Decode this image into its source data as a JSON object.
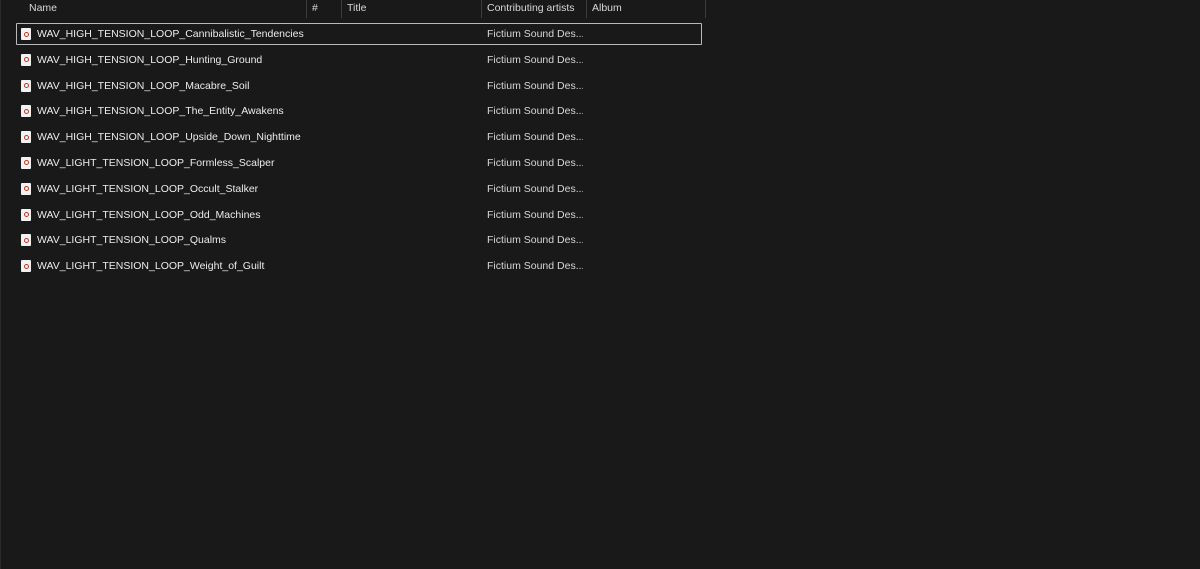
{
  "columns": {
    "name": "Name",
    "number": "#",
    "title": "Title",
    "contributing_artists": "Contributing artists",
    "album": "Album"
  },
  "files": [
    {
      "name": "WAV_HIGH_TENSION_LOOP_Cannibalistic_Tendencies",
      "artist": "Fictium Sound Des...",
      "selected": true,
      "icon": "audio-file-icon"
    },
    {
      "name": "WAV_HIGH_TENSION_LOOP_Hunting_Ground",
      "artist": "Fictium Sound Des...",
      "icon": "audio-file-icon"
    },
    {
      "name": "WAV_HIGH_TENSION_LOOP_Macabre_Soil",
      "artist": "Fictium Sound Des...",
      "icon": "audio-file-icon"
    },
    {
      "name": "WAV_HIGH_TENSION_LOOP_The_Entity_Awakens",
      "artist": "Fictium Sound Des...",
      "icon": "audio-file-icon"
    },
    {
      "name": "WAV_HIGH_TENSION_LOOP_Upside_Down_Nighttime",
      "artist": "Fictium Sound Des...",
      "icon": "audio-file-icon"
    },
    {
      "name": "WAV_LIGHT_TENSION_LOOP_Formless_Scalper",
      "artist": "Fictium Sound Des...",
      "icon": "audio-file-icon"
    },
    {
      "name": "WAV_LIGHT_TENSION_LOOP_Occult_Stalker",
      "artist": "Fictium Sound Des...",
      "icon": "audio-file-icon"
    },
    {
      "name": "WAV_LIGHT_TENSION_LOOP_Odd_Machines",
      "artist": "Fictium Sound Des...",
      "icon": "audio-file-icon"
    },
    {
      "name": "WAV_LIGHT_TENSION_LOOP_Qualms",
      "artist": "Fictium Sound Des...",
      "icon": "audio-file-icon"
    },
    {
      "name": "WAV_LIGHT_TENSION_LOOP_Weight_of_Guilt",
      "artist": "Fictium Sound Des...",
      "icon": "audio-file-icon"
    }
  ],
  "colors": {
    "background": "#191919",
    "text": "#ececec",
    "selection_border": "#b9b9b9"
  }
}
